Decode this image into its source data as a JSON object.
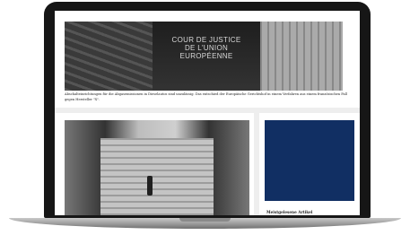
{
  "hero": {
    "sign_text": "COUR DE JUSTICE\nDE L'UNION\nEUROPÉENNE",
    "caption": "Abschalteinrichtungen für die Abgasemissionen in Dieselautos sind unzulässig. Das entschied der Europäische Gerichtshof in einem Verfahren aus einem französischen Fall gegen Hersteller \"X\"."
  },
  "sidebar": {
    "heading": "Meistgelesene Artikel",
    "ad_color": "#112f63"
  }
}
